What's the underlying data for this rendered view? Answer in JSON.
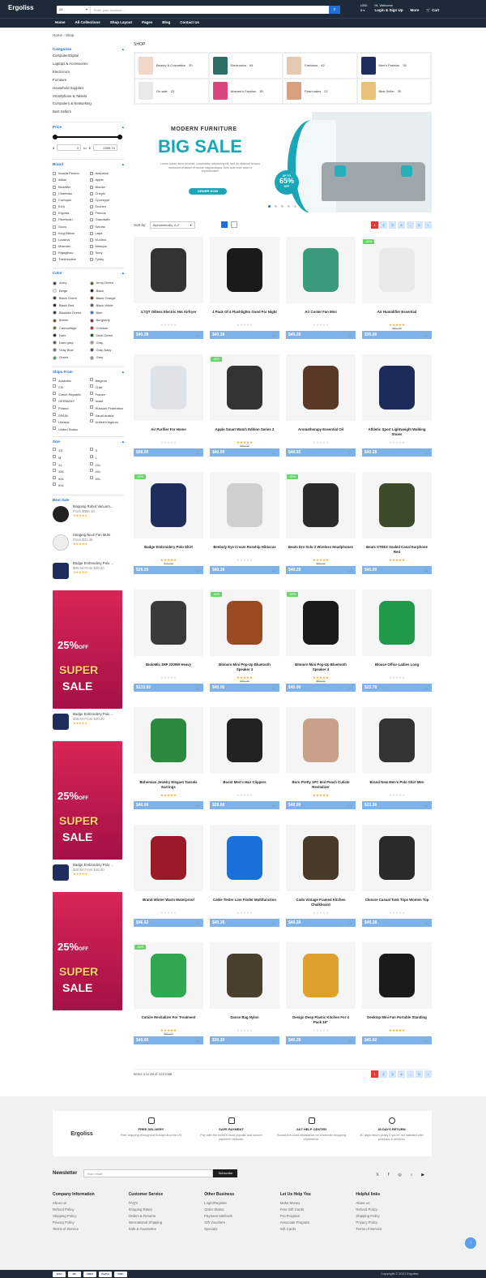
{
  "header": {
    "logo": "Ergoliss",
    "search_category": "All",
    "search_placeholder": "Enter your keyword ...",
    "currency": "USD",
    "greeting": "Hi, Welcome",
    "login": "Login & Sign Up",
    "more": "More",
    "cart": "Cart"
  },
  "nav": [
    "Home",
    "All Collections",
    "Shop Layout",
    "Pages",
    "Blog",
    "Contact Us"
  ],
  "breadcrumb": {
    "home": "Home",
    "current": "Shop"
  },
  "sidebar": {
    "categories_title": "Categories",
    "categories": [
      "Computer/Digital",
      "Laptops & Accessories",
      "Electronics",
      "Furniture",
      "Household Supplies",
      "Smartphone & Tablets",
      "Computers & Networking",
      "Best Sellers"
    ],
    "price_title": "Price",
    "price_min": "0",
    "price_max": "2999.70",
    "price_prefix": "$",
    "price_sep": "to",
    "price_filter": "$",
    "brand_title": "Brand",
    "brands": [
      "Acacia Person",
      "Acepesin",
      "Alisat",
      "Apple",
      "BioloMix",
      "Blouse",
      "Chafenko",
      "Cheyhi",
      "Comopsi",
      "Cpcxepye",
      "Ed'a",
      "Enchen",
      "Ergolss",
      "Feecoe",
      "Filterhush",
      "Grandwith",
      "Gucci",
      "Keiotto",
      "King Bilkon",
      "Lapa",
      "Luckina",
      "M-Alloo",
      "Maxmen",
      "Meeqoo",
      "Rigoglisso",
      "Sony",
      "Thermoview",
      "Tyeby"
    ],
    "color_title": "Color",
    "colors": [
      [
        "Army",
        "#3b3a2a"
      ],
      [
        "Army Green",
        "#4b5320"
      ],
      [
        "Beige",
        "#f5f0dc"
      ],
      [
        "Black",
        "#111111"
      ],
      [
        "Black Green",
        "#1f3a2a"
      ],
      [
        "Black Orange",
        "#5a2a10"
      ],
      [
        "Black Red",
        "#3a1010"
      ],
      [
        "Black White",
        "#555555"
      ],
      [
        "Blackish Green",
        "#23372b"
      ],
      [
        "Blue",
        "#1e6fd9"
      ],
      [
        "Brown",
        "#7a4a24"
      ],
      [
        "Burgundy",
        "#7d1d3f"
      ],
      [
        "Camouflage",
        "#6b6b3a"
      ],
      [
        "Crimson",
        "#c0142e"
      ],
      [
        "Dark",
        "#222222"
      ],
      [
        "Dark Green",
        "#0f4a20"
      ],
      [
        "Dark gray",
        "#555555"
      ],
      [
        "Gray",
        "#999999"
      ],
      [
        "Gray Blue",
        "#5b7189"
      ],
      [
        "Gray Navy",
        "#3b4a64"
      ],
      [
        "Green",
        "#2fa84f"
      ],
      [
        "Grey",
        "#8d8d8d"
      ]
    ],
    "ships_title": "Ships From",
    "ships": [
      "Australia",
      "Belgium",
      "CN",
      "Chile",
      "Czech Republic",
      "France",
      "GERMANY",
      "Israel",
      "Poland",
      "Russian Federation",
      "SPAIN",
      "Saudi Arabia",
      "Ukraine",
      "United Kingdom",
      "United States",
      ""
    ],
    "size_title": "Size",
    "sizes": [
      "XS",
      "S",
      "M",
      "L",
      "XL",
      "2XL",
      "3XL",
      "4XL",
      "5XL",
      "6XL",
      "6XL",
      ""
    ],
    "best_title": "Best Sale",
    "best_items": [
      {
        "name": "Mopping Robot Vacuum...",
        "price": "From $680.18",
        "stars": "★★★★★"
      },
      {
        "name": "Hanging Neck Fan Mute",
        "price": "From $32.49",
        "stars": "★★★★★"
      },
      {
        "name": "Badge Embroidery Polo ...",
        "price": "$30.94 From $20.20",
        "stars": "★★★★★"
      },
      {
        "name": "Badge Embroidery Polo ...",
        "price": "$30.94 From $20.20",
        "stars": "★★★★★"
      },
      {
        "name": "Badge Embroidery Polo ...",
        "price": "$30.94 From $20.20",
        "stars": "★★★★★"
      }
    ],
    "promo": {
      "percent": "25%",
      "off": "OFF",
      "super": "SUPER",
      "sale": "SALE"
    }
  },
  "shop": {
    "title": "SHOP",
    "categories": [
      {
        "label": "Beauty & Cosmetics",
        "count": "30"
      },
      {
        "label": "Electronics",
        "count": "64"
      },
      {
        "label": "Fashions",
        "count": "42"
      },
      {
        "label": "Men's Fashion",
        "count": "30"
      },
      {
        "label": "On sale",
        "count": "22"
      },
      {
        "label": "Women's Fashion",
        "count": "30"
      },
      {
        "label": "Flash sales",
        "count": "22"
      },
      {
        "label": "Best Seller",
        "count": "30"
      }
    ],
    "banner": {
      "kicker": "MODERN FURNITURE",
      "headline": "BIG SALE",
      "body": "Lorem ipsum dolor sit amet, consectetur adipiscing elit, sed do eiusmod tempor incididunt ut labore et dolore magna aliqua. Duis aute irure dolor in reprehenderit.",
      "cta": "ORDER NOW",
      "badge_up": "UP TO",
      "badge_pct": "65%",
      "badge_off": "OFF"
    },
    "sort_label": "Sort by:",
    "sort_value": "Alphabetically, A-Z",
    "pages": [
      "1",
      "2",
      "3",
      "4",
      "...",
      "5",
      "›"
    ],
    "results": "Items 1 to 28 of 122 total",
    "products": [
      {
        "name": "3.7QT Oilless Electric Hot Airfryer",
        "price": "$40.28",
        "old": "",
        "stars": "★★★★★",
        "rated": false,
        "tag": "",
        "color": "#333"
      },
      {
        "name": "4 Pack Of 4 Flashlights Good For Night",
        "price": "$40.28",
        "old": "",
        "stars": "★★★★★",
        "rated": false,
        "tag": "",
        "color": "#1a1a1a"
      },
      {
        "name": "Air Cooler Fan Mini",
        "price": "$40.28",
        "old": "",
        "stars": "★★★★★",
        "rated": false,
        "tag": "",
        "color": "#3c9a7c"
      },
      {
        "name": "Air Humidifier Essential",
        "price": "$30.00",
        "old": "$50.00",
        "stars": "★★★★★",
        "rated": true,
        "tag": "-40%",
        "color": "#e9e9e9"
      },
      {
        "name": "Air Purifier For Home",
        "price": "$98.00",
        "old": "",
        "stars": "★★★★★",
        "rated": false,
        "tag": "",
        "color": "#dfe3e8"
      },
      {
        "name": "Apple Smart Watch Edition Series 3",
        "price": "$40.00",
        "old": "$80.00",
        "stars": "★★★★★",
        "rated": true,
        "tag": "-50%",
        "color": "#333"
      },
      {
        "name": "Aromatherapy Essential Oil",
        "price": "$44.92",
        "old": "",
        "stars": "★★★★★",
        "rated": false,
        "tag": "",
        "color": "#5a3a26"
      },
      {
        "name": "Athletic Sport Lightweight Walking Shoes",
        "price": "$40.28",
        "old": "",
        "stars": "★★★★★",
        "rated": false,
        "tag": "",
        "color": "#1c2b5a"
      },
      {
        "name": "Badge Embroidery Polo Shirt",
        "price": "$20.20",
        "old": "$30.00",
        "stars": "★★★★★",
        "rated": true,
        "tag": "-40%",
        "color": "#1f2d5c"
      },
      {
        "name": "Beeboly Eye Cream Rosehip Hibiscus",
        "price": "$40.28",
        "old": "",
        "stars": "★★★★★",
        "rated": false,
        "tag": "",
        "color": "#cfcfcf"
      },
      {
        "name": "Beats Dre Solo 2 Wireless Headphones",
        "price": "$40.28",
        "old": "$80.00",
        "stars": "★★★★★",
        "rated": true,
        "tag": "-50%",
        "color": "#2b2b2b"
      },
      {
        "name": "Beats STEEZ Sealed Canal Earphone Red",
        "price": "$40.00",
        "old": "",
        "stars": "★★★★★",
        "rated": true,
        "tag": "",
        "color": "#3c4a2a"
      },
      {
        "name": "BioloMix 3HP 2200W Heavy",
        "price": "$133.92",
        "old": "",
        "stars": "★★★★★",
        "rated": false,
        "tag": "",
        "color": "#3a3a3a"
      },
      {
        "name": "Bitmore Mini Pop-Up Bluetooth Speaker 4",
        "price": "$40.00",
        "old": "$80.00",
        "stars": "★★★★★",
        "rated": true,
        "tag": "-50%",
        "color": "#9a4a22"
      },
      {
        "name": "Bitmore Mini Pop-Up Bluetooth Speaker 4",
        "price": "$40.00",
        "old": "$80.00",
        "stars": "★★★★★",
        "rated": true,
        "tag": "-50%",
        "color": "#1a1a1a"
      },
      {
        "name": "Blouse Office Ladies Long",
        "price": "$22.78",
        "old": "",
        "stars": "★★★★★",
        "rated": false,
        "tag": "",
        "color": "#1e9a4a"
      },
      {
        "name": "Bohemian Jewelry Elegant Tassels Earrings",
        "price": "$40.00",
        "old": "",
        "stars": "★★★★★",
        "rated": true,
        "tag": "",
        "color": "#2b8a3e"
      },
      {
        "name": "Boost Men's Hair Clippers",
        "price": "$28.68",
        "old": "",
        "stars": "★★★★★",
        "rated": false,
        "tag": "",
        "color": "#222"
      },
      {
        "name": "Born Pretty 1PC 8ml Peach Cuticle Revitalizer",
        "price": "$40.00",
        "old": "",
        "stars": "★★★★★",
        "rated": true,
        "tag": "",
        "color": "#c9a18a"
      },
      {
        "name": "Brand New Men's Polo Shirt Men",
        "price": "$23.36",
        "old": "",
        "stars": "★★★★★",
        "rated": false,
        "tag": "",
        "color": "#333"
      },
      {
        "name": "Brand Winter Warm Waterproof",
        "price": "$46.52",
        "old": "",
        "stars": "★★★★★",
        "rated": false,
        "tag": "",
        "color": "#9a1a2a"
      },
      {
        "name": "Cable Tester Line Finder Multifunction",
        "price": "$40.28",
        "old": "",
        "stars": "★★★★★",
        "rated": false,
        "tag": "",
        "color": "#1a6fd9"
      },
      {
        "name": "Cado Vintage Framed Kitchen Chalkboard",
        "price": "$40.28",
        "old": "",
        "stars": "★★★★★",
        "rated": false,
        "tag": "",
        "color": "#4a3a2a"
      },
      {
        "name": "Closure Casual Tank Tops Women Top",
        "price": "$40.28",
        "old": "",
        "stars": "★★★★★",
        "rated": false,
        "tag": "",
        "color": "#2a2a2a"
      },
      {
        "name": "Cuticle Revitalizer For Treatment",
        "price": "$40.00",
        "old": "$80.00",
        "stars": "★★★★★",
        "rated": true,
        "tag": "-50%",
        "color": "#2fa84f"
      },
      {
        "name": "Dance Bag Nylon",
        "price": "$30.20",
        "old": "",
        "stars": "★★★★★",
        "rated": false,
        "tag": "",
        "color": "#4a4030"
      },
      {
        "name": "Design Deep Plastic Kitchen For 4 Pack 16\"",
        "price": "$40.28",
        "old": "",
        "stars": "★★★★★",
        "rated": false,
        "tag": "",
        "color": "#e0a030"
      },
      {
        "name": "Desktop Mini Fan Portable Standing",
        "price": "$45.92",
        "old": "",
        "stars": "★★★★★",
        "rated": true,
        "tag": "",
        "color": "#1a1a1a"
      }
    ]
  },
  "footer": {
    "logo": "Ergoliss",
    "features": [
      {
        "title": "FREE DELIVERY",
        "text": "Free shipping throughout Europe and the US"
      },
      {
        "title": "SAFE PAYMENT",
        "text": "Pay with the world's most popular and secure payment methods."
      },
      {
        "title": "24/7 HELP CENTER",
        "text": "Round-the-clock assistance for a smooth shopping experience."
      },
      {
        "title": "30 DAYS RETURN",
        "text": "30 days return policy if you're not satisfied with products & services"
      }
    ],
    "newsletter_label": "Newsletter",
    "newsletter_placeholder": "Your email",
    "subscribe": "Subscribe",
    "social": [
      "𝕏",
      "f",
      "◎",
      "♪",
      "▶"
    ],
    "columns": [
      {
        "title": "Company Information",
        "links": [
          "About us",
          "Refund Policy",
          "Shipping Policy",
          "Privacy Policy",
          "Terms of Service"
        ]
      },
      {
        "title": "Customer Service",
        "links": [
          "FAQ's",
          "Shipping Rates",
          "Orders & Returns",
          "International Shipping",
          "Safe & Guarantee"
        ]
      },
      {
        "title": "Other Business",
        "links": [
          "Login/Register",
          "Order Status",
          "Payment Methods",
          "Gift Vouchers",
          "Specials"
        ]
      },
      {
        "title": "Let Us Help You",
        "links": [
          "Make Money",
          "Free Gift Cards",
          "Pro Program",
          "Associate Program",
          "Gift Cards"
        ]
      },
      {
        "title": "Helpful links",
        "links": [
          "About us",
          "Refund Policy",
          "Shipping Policy",
          "Privacy Policy",
          "Terms of Service"
        ]
      }
    ],
    "payments": [
      "VISA",
      "MC",
      "AMEX",
      "PayPal",
      "DISC"
    ],
    "copyright": "Copyright © 2021 Ergoliss"
  }
}
